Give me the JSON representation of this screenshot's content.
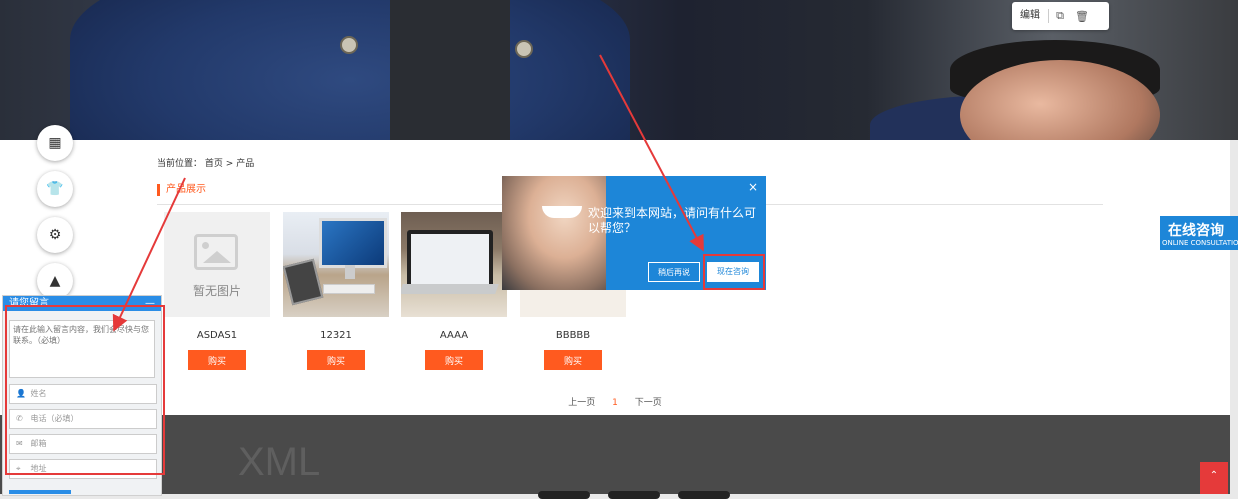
{
  "edit_toolbar": {
    "edit_label": "编辑",
    "copy_icon": "copy-icon",
    "delete_icon": "trash-icon"
  },
  "breadcrumb": {
    "prefix": "当前位置：",
    "home": "首页",
    "separator": ">",
    "current": "产品"
  },
  "section_title": "产品展示",
  "no_image_text": "暂无图片",
  "products": [
    {
      "name": "ASDAS1",
      "buy_label": "购买"
    },
    {
      "name": "12321",
      "buy_label": "购买"
    },
    {
      "name": "AAAA",
      "buy_label": "购买"
    },
    {
      "name": "BBBBB",
      "buy_label": "购买"
    }
  ],
  "pagination": {
    "prev": "上一页",
    "current": "1",
    "next": "下一页"
  },
  "footer": {
    "logo_text": "XML"
  },
  "message_panel": {
    "title": "请您留言",
    "minimize": "—",
    "content_placeholder": "请在此输入留言内容，我们会尽快与您联系。（必填）",
    "name_placeholder": "姓名",
    "phone_placeholder": "电话（必填）",
    "email_placeholder": "邮箱",
    "address_placeholder": "地址"
  },
  "chat_popup": {
    "message": "欢迎来到本网站，请问有什么可以帮您？",
    "close": "×",
    "later_label": "稍后再说",
    "now_label": "现在咨询"
  },
  "online_consult": {
    "title": "在线咨询",
    "subtitle": "ONLINE CONSULTATION"
  },
  "back_to_top": "⌃",
  "colors": {
    "accent": "#ff5a1f",
    "chat_blue": "#1d86d8",
    "annotation_red": "#e53a3a"
  }
}
